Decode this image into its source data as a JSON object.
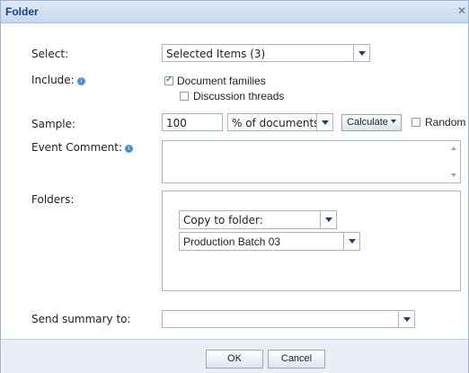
{
  "dialog": {
    "title": "Folder",
    "close_label": "✕"
  },
  "select": {
    "label": "Select:",
    "value": "Selected Items (3)"
  },
  "include": {
    "label": "Include:",
    "options": [
      {
        "label": "Document families",
        "checked": true
      },
      {
        "label": "Discussion threads",
        "checked": false
      }
    ]
  },
  "sample": {
    "label": "Sample:",
    "value": "100",
    "unit": "% of documents",
    "calculate_label": "Calculate",
    "random_label": "Random",
    "random_checked": false
  },
  "event_comment": {
    "label": "Event Comment:",
    "value": ""
  },
  "folders": {
    "label": "Folders:",
    "action": "Copy to folder:",
    "folder": "Production Batch 03"
  },
  "send_summary": {
    "label": "Send summary to:",
    "value": ""
  },
  "footer": {
    "ok_label": "OK",
    "cancel_label": "Cancel"
  }
}
